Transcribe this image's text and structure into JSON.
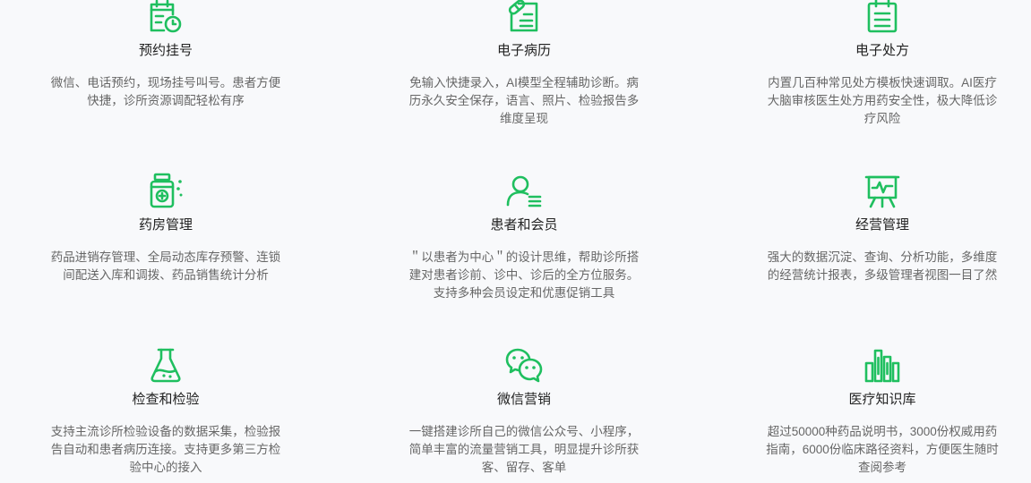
{
  "accent_color": "#1fbf5f",
  "features": [
    {
      "icon": "calendar-clock-icon",
      "title": "预约挂号",
      "desc": "微信、电话预约，现场挂号叫号。患者方便快捷，诊所资源调配轻松有序"
    },
    {
      "icon": "medical-record-icon",
      "title": "电子病历",
      "desc": "免输入快捷录入，AI模型全程辅助诊断。病历永久安全保存，语言、照片、检验报告多维度呈现"
    },
    {
      "icon": "prescription-clipboard-icon",
      "title": "电子处方",
      "desc": "内置几百种常见处方模板快速调取。AI医疗大脑审核医生处方用药安全性，极大降低诊疗风险"
    },
    {
      "icon": "medicine-bottle-icon",
      "title": "药房管理",
      "desc": "药品进销存管理、全局动态库存预警、连锁间配送入库和调拨、药品销售统计分析"
    },
    {
      "icon": "patient-member-icon",
      "title": "患者和会员",
      "desc": "＂以患者为中心＂的设计思维，帮助诊所搭建对患者诊前、诊中、诊后的全方位服务。支持多种会员设定和优惠促销工具"
    },
    {
      "icon": "presentation-board-icon",
      "title": "经营管理",
      "desc": "强大的数据沉淀、查询、分析功能，多维度的经营统计报表，多级管理者视图一目了然"
    },
    {
      "icon": "lab-flask-icon",
      "title": "检查和检验",
      "desc": "支持主流诊所检验设备的数据采集，检验报告自动和患者病历连接。支持更多第三方检验中心的接入"
    },
    {
      "icon": "wechat-icon",
      "title": "微信营销",
      "desc": "一键搭建诊所自己的微信公众号、小程序，简单丰富的流量营销工具，明显提升诊所获客、留存、客单"
    },
    {
      "icon": "bar-chart-books-icon",
      "title": "医疗知识库",
      "desc": "超过50000种药品说明书，3000份权威用药指南，6000份临床路径资料，方便医生随时查阅参考"
    }
  ]
}
